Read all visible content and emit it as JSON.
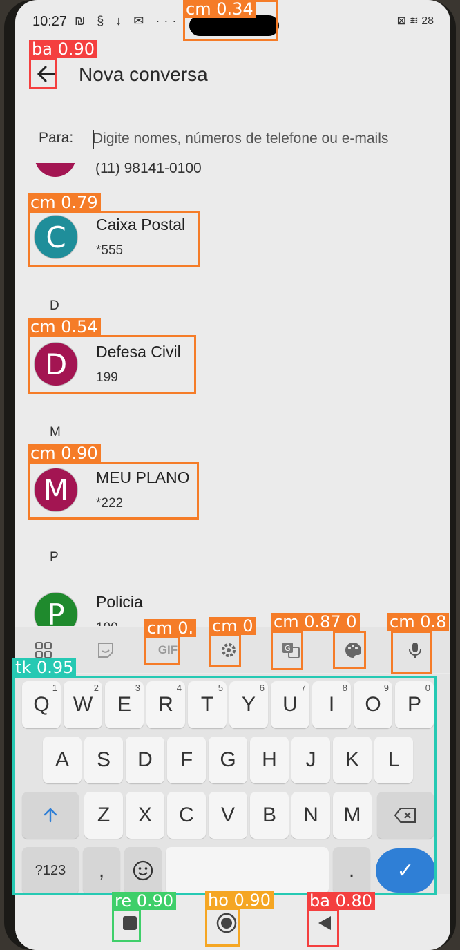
{
  "status_bar": {
    "time": "10:27",
    "left_icons": "₪ § ↓ ✉ ···",
    "right_icons": "⊠ ≋ 28"
  },
  "app_bar": {
    "title": "Nova conversa"
  },
  "to_field": {
    "label": "Para:",
    "placeholder": "Digite nomes, números de telefone ou e-mails"
  },
  "contacts": {
    "partial_number": "(11) 98141-0100",
    "sections": [
      "D",
      "M",
      "P"
    ],
    "items": [
      {
        "initial": "C",
        "name": "Caixa Postal",
        "number": "*555",
        "color": "#1f8e9a"
      },
      {
        "initial": "D",
        "name": "Defesa Civil",
        "number": "199",
        "color": "#a31552"
      },
      {
        "initial": "M",
        "name": "MEU PLANO",
        "number": "*222",
        "color": "#a31552"
      },
      {
        "initial": "P",
        "name": "Policia",
        "number": "190",
        "color": "#1f8a2d"
      }
    ]
  },
  "keyboard": {
    "toolbar": [
      "apps-icon",
      "sticker-icon",
      "GIF",
      "settings-icon",
      "translate-icon",
      "palette-icon",
      "mic-icon"
    ],
    "row1": [
      "Q",
      "W",
      "E",
      "R",
      "T",
      "Y",
      "U",
      "I",
      "O",
      "P"
    ],
    "row1_hints": [
      "1",
      "2",
      "3",
      "4",
      "5",
      "6",
      "7",
      "8",
      "9",
      "0"
    ],
    "row2": [
      "A",
      "S",
      "D",
      "F",
      "G",
      "H",
      "J",
      "K",
      "L"
    ],
    "row3": [
      "Z",
      "X",
      "C",
      "V",
      "B",
      "N",
      "M"
    ],
    "symbols_key": "?123",
    "comma": ",",
    "period": ".",
    "emoji": "☺",
    "enter": "✓"
  },
  "detections": [
    {
      "label": "cm 0.34",
      "color": "#f57c28"
    },
    {
      "label": "ba 0.90",
      "color": "#f43f3f"
    },
    {
      "label": "cm 0.79",
      "color": "#f57c28"
    },
    {
      "label": "cm 0.54",
      "color": "#f57c28"
    },
    {
      "label": "cm 0.90",
      "color": "#f57c28"
    },
    {
      "label": "cm 0.",
      "color": "#f57c28"
    },
    {
      "label": "cm 0",
      "color": "#f57c28"
    },
    {
      "label": "cm 0.87 0",
      "color": "#f57c28"
    },
    {
      "label": "cm 0.8",
      "color": "#f57c28"
    },
    {
      "label": "tk 0.95",
      "color": "#26c9b3"
    },
    {
      "label": "re 0.90",
      "color": "#3fcf6a"
    },
    {
      "label": "ho 0.90",
      "color": "#f5a623"
    },
    {
      "label": "ba 0.80",
      "color": "#f43f3f"
    }
  ]
}
